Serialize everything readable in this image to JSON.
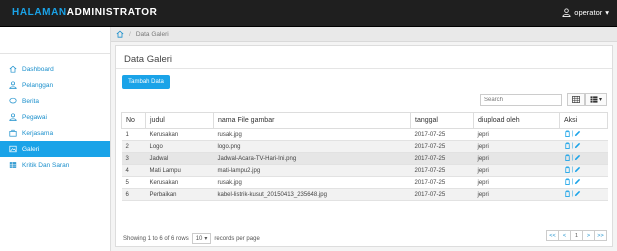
{
  "header": {
    "brand_highlight": "HALAMAN",
    "brand_rest": "ADMINISTRATOR",
    "user": "operator"
  },
  "breadcrumb": {
    "current": "Data Galeri"
  },
  "sidebar": {
    "items": [
      {
        "label": "Dashboard",
        "icon": "home-icon"
      },
      {
        "label": "Pelanggan",
        "icon": "user-icon"
      },
      {
        "label": "Berita",
        "icon": "bubble-icon"
      },
      {
        "label": "Pegawai",
        "icon": "user-icon"
      },
      {
        "label": "Kerjasama",
        "icon": "briefcase-icon"
      },
      {
        "label": "Galeri",
        "icon": "image-icon",
        "active": true
      },
      {
        "label": "Kritik Dan Saran",
        "icon": "table-icon"
      }
    ]
  },
  "panel": {
    "title": "Data Galeri",
    "add_button": "Tambah Data",
    "search_placeholder": "Search"
  },
  "table": {
    "headers": [
      "No",
      "judul",
      "nama File gambar",
      "tanggal",
      "diupload oleh",
      "Aksi"
    ],
    "rows": [
      [
        "1",
        "Kerusakan",
        "rusak.jpg",
        "2017-07-25",
        "jepri"
      ],
      [
        "2",
        "Logo",
        "logo.png",
        "2017-07-25",
        "jepri"
      ],
      [
        "3",
        "Jadwal",
        "Jadwal-Acara-TV-Hari-Ini.png",
        "2017-07-25",
        "jepri"
      ],
      [
        "4",
        "Mati Lampu",
        "mati-lampu2.jpg",
        "2017-07-25",
        "jepri"
      ],
      [
        "5",
        "Kerusakan",
        "rusak.jpg",
        "2017-07-25",
        "jepri"
      ],
      [
        "6",
        "Perbaikan",
        "kabel-listrik-kusut_20150413_235648.jpg",
        "2017-07-25",
        "jepri"
      ]
    ]
  },
  "footer": {
    "showing": "Showing 1 to 6 of 6 rows",
    "page_size": "10",
    "per_page": "records per page",
    "pager": [
      "<<",
      "<",
      "1",
      ">",
      ">>"
    ]
  },
  "colors": {
    "accent": "#1aa3e8",
    "topbar": "#1f1f1f"
  }
}
